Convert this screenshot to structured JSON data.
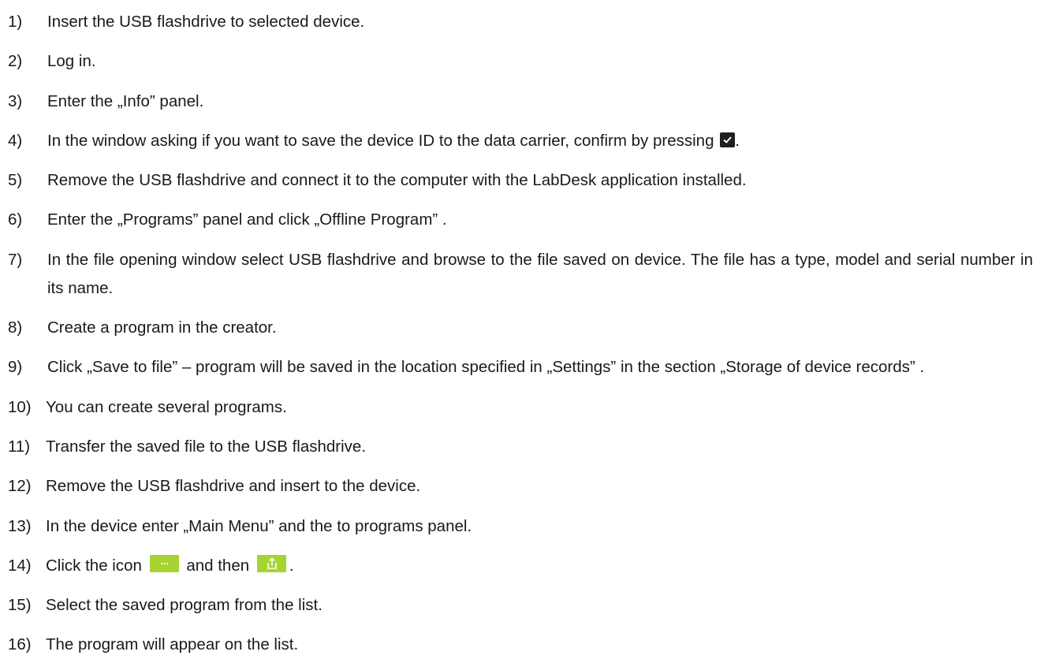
{
  "steps": [
    {
      "num": "1)",
      "text": "Insert the USB flashdrive to selected device."
    },
    {
      "num": "2)",
      "text": "Log in."
    },
    {
      "num": "3)",
      "text": "Enter the „Info” panel."
    },
    {
      "num": "4)",
      "text": "In the window asking if you want to save the device ID to the data carrier, confirm by pressing",
      "suffix": "."
    },
    {
      "num": "5)",
      "text": "Remove the USB flashdrive and connect it to the computer with the LabDesk application installed."
    },
    {
      "num": "6)",
      "text": "Enter the „Programs” panel and click „Offline Program” ."
    },
    {
      "num": "7)",
      "text": "In the file opening window select USB flashdrive and browse to the file saved on device. The file has a type, model and serial number in its name."
    },
    {
      "num": "8)",
      "text": "Create a program in the creator."
    },
    {
      "num": "9)",
      "text": "Click „Save to file” – program will be saved in the location specified in „Settings” in the section „Storage of device records” ."
    },
    {
      "num": "10)",
      "text": "You can create several programs."
    },
    {
      "num": "11)",
      "text": "Transfer the saved file to the USB flashdrive."
    },
    {
      "num": "12)",
      "text": "Remove the USB flashdrive and insert to the device."
    },
    {
      "num": "13)",
      "text": "In the device enter „Main Menu” and the to programs panel."
    },
    {
      "num": "14)",
      "text": "Click the icon",
      "middle": "and then",
      "suffix": "."
    },
    {
      "num": "15)",
      "text": "Select the saved program from the list."
    },
    {
      "num": "16)",
      "text": "The program will appear on the list."
    }
  ],
  "icons": {
    "confirm": "check-icon",
    "more": "more-options-icon",
    "import": "import-icon",
    "accent_color": "#a6d532"
  }
}
